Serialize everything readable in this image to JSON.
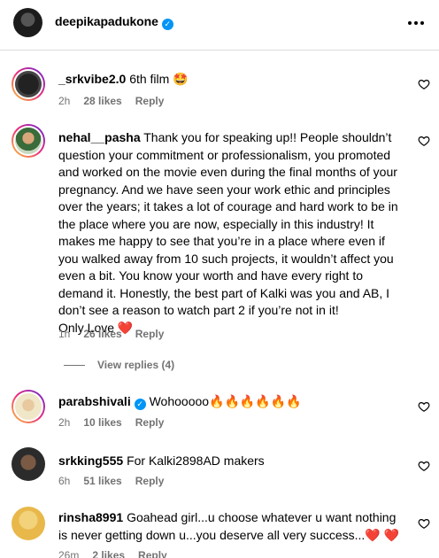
{
  "header": {
    "username": "deepikapadukone",
    "verified": true,
    "more_icon": "more-horizontal-icon"
  },
  "comments": [
    {
      "username": "_srkvibe2.0",
      "text": "6th film 🤩",
      "time": "2h",
      "likes": "28 likes",
      "reply": "Reply"
    },
    {
      "username": "nehal__pasha",
      "text": "Thank you for speaking up!! People shouldn’t question your commitment or professionalism, you promoted and worked on the movie even during the final months of your pregnancy. And we have seen your work ethic and principles over the years; it takes a lot of courage and hard work to be in the place where you are now, especially in this industry! It makes me happy to see that you’re in a place where even if you walked away from 10 such projects, it wouldn’t affect you even a bit. You know your worth and have every right to demand it. Honestly, the best part of Kalki was you and AB, I don’t see a reason to watch part 2 if you’re not in it!",
      "text2": "Only Love ❤️",
      "time": "1h",
      "likes": "26 likes",
      "reply": "Reply",
      "view_replies": "View replies (4)"
    },
    {
      "username": "parabshivali",
      "verified": true,
      "text": "Wohooooo🔥🔥🔥🔥🔥🔥",
      "time": "2h",
      "likes": "10 likes",
      "reply": "Reply"
    },
    {
      "username": "srkking555",
      "text": "For Kalki2898AD makers",
      "time": "6h",
      "likes": "51 likes",
      "reply": "Reply"
    },
    {
      "username": "rinsha8991",
      "text": "Goahead girl...u choose whatever u want nothing is never getting down u...you deserve all very success...❤️ ❤️",
      "time": "26m",
      "likes": "2 likes",
      "reply": "Reply"
    }
  ],
  "colors": {
    "verified_blue": "#0095f6",
    "meta_gray": "#737373",
    "divider": "#dbdbdb"
  }
}
